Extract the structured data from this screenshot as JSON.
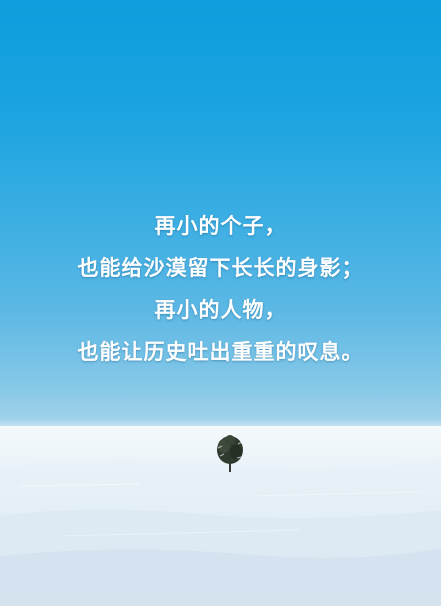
{
  "poem": {
    "lines": [
      "再小的个子，",
      "也能给沙漠留下长长的身影；",
      "再小的人物，",
      "也能让历史吐出重重的叹息。"
    ]
  },
  "colors": {
    "sky_top": "#0f9ddd",
    "sky_horizon": "#a9d5ec",
    "snow": "#eaf3f9",
    "text": "#ffffff"
  }
}
